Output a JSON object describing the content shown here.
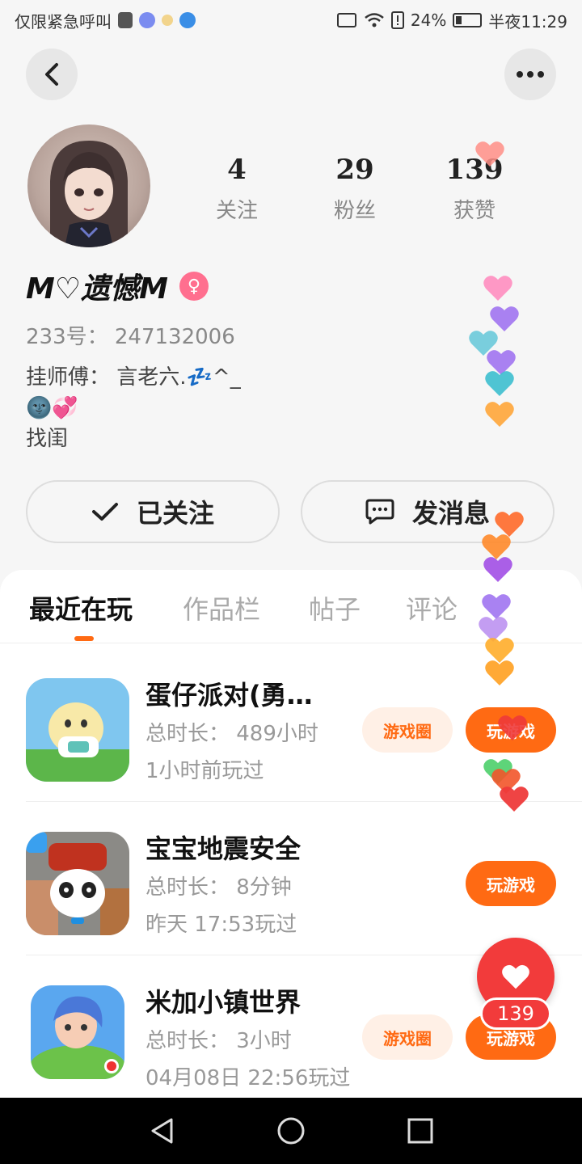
{
  "status_bar": {
    "left_text": "仅限紧急呼叫",
    "battery": "24%",
    "time": "半夜11:29"
  },
  "profile": {
    "stats": [
      {
        "value": "4",
        "label": "关注"
      },
      {
        "value": "29",
        "label": "粉丝"
      },
      {
        "value": "139",
        "label": "获赞"
      }
    ],
    "username": "M♡遗憾M",
    "gender_symbol": "♀",
    "uid": "233号： 247132006",
    "bio_lines": [
      "挂师傅： 言老六.💤^_",
      "🌚💞",
      "找闺"
    ]
  },
  "actions": {
    "follow_label": "已关注",
    "message_label": "发消息"
  },
  "tabs": [
    "最近在玩",
    "作品栏",
    "帖子",
    "评论"
  ],
  "games": [
    {
      "name": "蛋仔派对(勇…",
      "duration": "总时长： 489小时",
      "last_played": "1小时前玩过",
      "circle_label": "游戏圈",
      "play_label": "玩游戏"
    },
    {
      "name": "宝宝地震安全",
      "duration": "总时长： 8分钟",
      "last_played": "昨天 17:53玩过",
      "play_label": "玩游戏"
    },
    {
      "name": "米加小镇世界",
      "duration": "总时长： 3小时",
      "last_played": "04月08日 22:56玩过",
      "circle_label": "游戏圈",
      "play_label": "玩游戏"
    }
  ],
  "like": {
    "count": "139"
  },
  "colors": {
    "accent": "#ff6a13",
    "like_red": "#f23b3b",
    "gender_pink": "#ff6f8f"
  },
  "icons": [
    "back-arrow-icon",
    "more-dots-icon",
    "checkmark-icon",
    "chat-bubble-icon",
    "heart-icon",
    "nav-back-icon",
    "nav-home-icon",
    "nav-recents-icon"
  ]
}
